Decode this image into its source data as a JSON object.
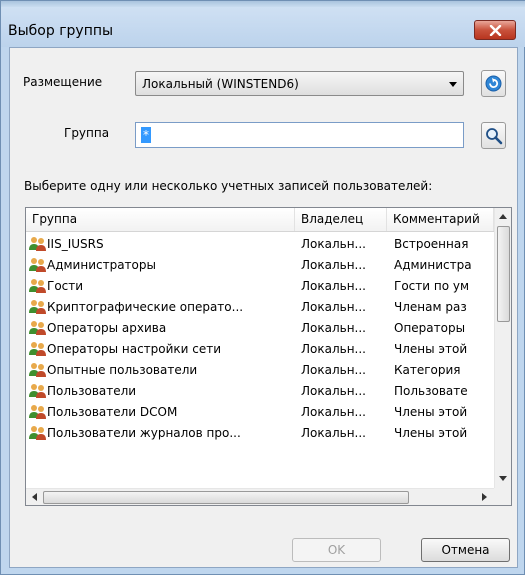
{
  "window": {
    "title": "Выбор группы"
  },
  "location": {
    "label": "Размещение",
    "value": "Локальный (WINSTEND6)"
  },
  "group": {
    "label": "Группа",
    "value": "*"
  },
  "instructions": "Выберите одну или несколько учетных записей пользователей:",
  "table": {
    "columns": [
      "Группа",
      "Владелец",
      "Комментарий"
    ],
    "rows": [
      [
        "IIS_IUSRS",
        "Локальн...",
        "Встроенная"
      ],
      [
        "Администраторы",
        "Локальн...",
        "Администра"
      ],
      [
        "Гости",
        "Локальн...",
        "Гости по ум"
      ],
      [
        "Криптографические операто...",
        "Локальн...",
        "Членам раз"
      ],
      [
        "Операторы архива",
        "Локальн...",
        "Операторы"
      ],
      [
        "Операторы настройки сети",
        "Локальн...",
        "Члены этой"
      ],
      [
        "Опытные пользователи",
        "Локальн...",
        "Категория"
      ],
      [
        "Пользователи",
        "Локальн...",
        "Пользовате"
      ],
      [
        "Пользователи DCOM",
        "Локальн...",
        "Члены этой"
      ],
      [
        "Пользователи журналов про...",
        "Локальн...",
        "Члены этой"
      ]
    ]
  },
  "buttons": {
    "ok": "OK",
    "cancel": "Отмена"
  },
  "icons": {
    "refresh": "refresh-icon",
    "search": "search-icon",
    "group": "group-icon",
    "close": "close-icon"
  },
  "colors": {
    "selection": "#3399ff",
    "close_button": "#c9523c",
    "title_bar": "#bfd6ee"
  }
}
